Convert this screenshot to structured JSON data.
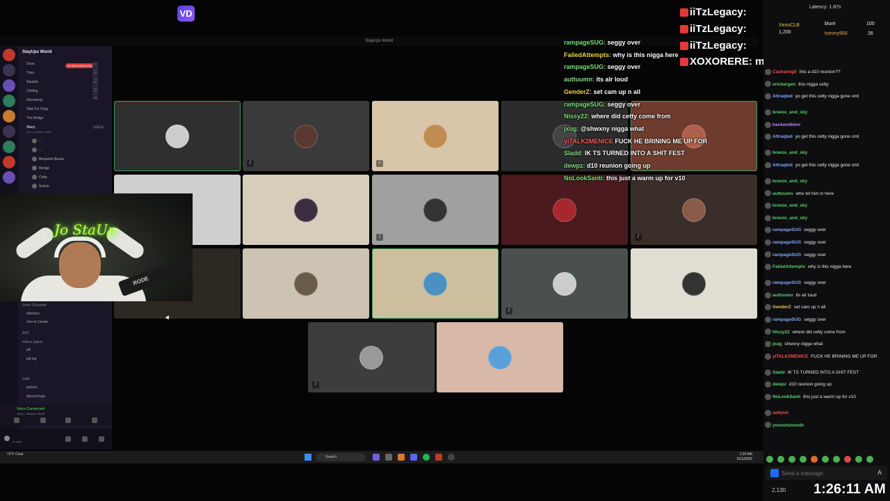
{
  "top_logo": "VD",
  "window_title": "StayUps World",
  "discord": {
    "server_name": "StayUps World",
    "mention_badge": "99 NEW MENTIONS",
    "channels": [
      {
        "label": "Duos",
        "count": "00 · 02"
      },
      {
        "label": "Trios",
        "count": "00 · 03"
      },
      {
        "label": "Squads",
        "count": "00 · 04"
      },
      {
        "label": "Chilling",
        "count": "00 · 99"
      },
      {
        "label": "Streaming",
        "count": ""
      },
      {
        "label": "Wait For Drag",
        "count": ""
      },
      {
        "label": "The Bridge",
        "count": ""
      },
      {
        "label": "Stacy",
        "count": "3:33:12"
      }
    ],
    "status_hint": "Set a channel status",
    "members": [
      "...",
      "...",
      "Benjamin Bucks",
      "Iboogz",
      "Cetty",
      "Grinch"
    ],
    "voice_section": "Voice Channels",
    "voice_items": [
      "interface",
      "Join to Create"
    ],
    "afk": "AFK",
    "hikers": "Hikers Island",
    "text_channels": [
      "jail",
      "jail-log"
    ],
    "staff": "Staff",
    "staff_channels": [
      "lackers",
      "discord-logs"
    ],
    "voice_connected": "Voice Connected",
    "voice_sub": "Stacy / StayUps World",
    "user_sub": "In voice"
  },
  "webcam": {
    "neon_text": "Jo StaUp",
    "mic_brand": "RODE"
  },
  "overlay_big": [
    "iiTzLegacy:",
    "iiTzLegacy:",
    "iiTzLegacy:",
    "XOXORERE: man size don't matter"
  ],
  "overlay_chat": [
    {
      "name": "rampageSUG:",
      "text": "seggy over",
      "color": "n"
    },
    {
      "name": "FailedAttempts:",
      "text": "why is this nigga here",
      "color": "y"
    },
    {
      "name": "rampageSUG:",
      "text": "seggy over",
      "color": "n"
    },
    {
      "name": "auttuumn:",
      "text": "its alr loud",
      "color": "n"
    },
    {
      "name": "GenderZ:",
      "text": "set cam up n all",
      "color": "y"
    },
    {
      "name": "rampageSUG:",
      "text": "seggy over",
      "color": "n"
    },
    {
      "name": "Nissy22:",
      "text": "where did cetty come from",
      "color": "n"
    },
    {
      "name": "jxug:",
      "text": "@shwxny nigga what",
      "color": "n"
    },
    {
      "name": "yiTALK2MENICE",
      "text": "FUCK HE BRINING ME UP FOR",
      "color": "r"
    },
    {
      "name": "Sladd:",
      "text": "IK TS TURNED INTO A SHIT FEST",
      "color": "n"
    },
    {
      "name": "dewpz:",
      "text": "d10 reunion going up",
      "color": "n"
    },
    {
      "name": "NoLookSanti:",
      "text": "this just a warm up for v10",
      "color": "n"
    }
  ],
  "twitch": {
    "latency": "Latency: 1.87s",
    "gifters": [
      {
        "name": "XenoCLB",
        "value": "1,200"
      },
      {
        "name": "blurri",
        "value": "100"
      },
      {
        "name": "tommy900",
        "value": "26"
      }
    ],
    "messages": [
      {
        "name": "Cashamig0",
        "text": "this a d10 reunion??",
        "color": "c-red"
      },
      {
        "name": "ericbergen",
        "text": "this nigga cetty",
        "color": "c-green"
      },
      {
        "name": "Attraqted",
        "text": "yo get this cetty nigga gone oml",
        "color": "c-blue"
      },
      {
        "name": "breeze_and_sky",
        "text": "",
        "color": "c-green"
      },
      {
        "name": "backendbino",
        "text": "",
        "color": "c-purple"
      },
      {
        "name": "Attraqted",
        "text": "yo get this cetty nigga gone oml",
        "color": "c-blue"
      },
      {
        "name": "breeze_and_sky",
        "text": "",
        "color": "c-green"
      },
      {
        "name": "Attraqted",
        "text": "yo get this cetty nigga gone oml",
        "color": "c-blue"
      },
      {
        "name": "breeze_and_sky",
        "text": "",
        "color": "c-green"
      },
      {
        "name": "auttuumn",
        "text": "who let him in here",
        "color": "c-green"
      },
      {
        "name": "breeze_and_sky",
        "text": "",
        "color": "c-green"
      },
      {
        "name": "breeze_and_sky",
        "text": "",
        "color": "c-green"
      },
      {
        "name": "rampageSUG",
        "text": "seggy over",
        "color": "c-blue"
      },
      {
        "name": "rampageSUG",
        "text": "seggy over",
        "color": "c-blue"
      },
      {
        "name": "rampageSUG",
        "text": "seggy over",
        "color": "c-blue"
      },
      {
        "name": "FailedAttempts",
        "text": "why is this nigga here",
        "color": "c-green"
      },
      {
        "name": "rampageSUG",
        "text": "seggy over",
        "color": "c-blue"
      },
      {
        "name": "auttuumn",
        "text": "its alr loud",
        "color": "c-green"
      },
      {
        "name": "GenderZ",
        "text": "set cam up n all",
        "color": "c-gold"
      },
      {
        "name": "rampageSUG",
        "text": "seggy over",
        "color": "c-blue"
      },
      {
        "name": "Nissy22",
        "text": "where did cetty come from",
        "color": "c-green"
      },
      {
        "name": "jxug",
        "text": "shwxny  nigga what",
        "color": "c-green"
      },
      {
        "name": "yiTALK2MENICE",
        "text": "FUCK HE BRINING ME UP FOR",
        "color": "c-red"
      },
      {
        "name": "Sladd",
        "text": "IK TS TURNED INTO A SHIT FEST",
        "color": "c-green"
      },
      {
        "name": "dewpz",
        "text": "d10 reunion going up",
        "color": "c-green"
      },
      {
        "name": "NoLookSanti",
        "text": "this just a warm up for v10",
        "color": "c-green"
      },
      {
        "name": "settylol",
        "text": "",
        "color": "c-red"
      },
      {
        "name": "younotsmooth",
        "text": "",
        "color": "c-green"
      }
    ],
    "placeholder": "Send a message",
    "points": "2,130",
    "clock": "1:26:11 AM"
  },
  "taskbar": {
    "weather": "73°F Clear",
    "search": "Search",
    "time": "1:26 AM",
    "date": "5/11/2026"
  },
  "colors": {
    "accent": "#3ba55d",
    "twitch": "#1f69ff",
    "discord_bg": "#1a1628"
  }
}
